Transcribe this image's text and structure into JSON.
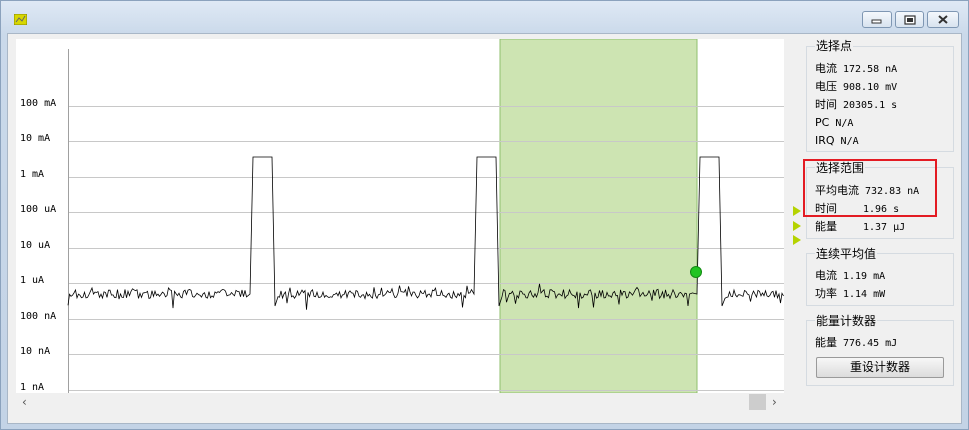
{
  "plot": {
    "y_tick_labels": [
      "100 mA",
      "10 mA",
      "1 mA",
      "100 uA",
      "10 uA",
      "1 uA",
      "100 nA",
      "10 nA",
      "1 nA"
    ],
    "selection_color": "#cde4b2",
    "trace_color": "#000000",
    "marker_color": "#22c422"
  },
  "selected_point": {
    "title": "选择点",
    "current_label": "电流",
    "current_value": "172.58 nA",
    "voltage_label": "电压",
    "voltage_value": "908.10 mV",
    "time_label": "时间",
    "time_value": "20305.1 s",
    "pc_label": "PC",
    "pc_value": "N/A",
    "irq_label": "IRQ",
    "irq_value": "N/A"
  },
  "selection_range": {
    "title": "选择范围",
    "avg_current_label": "平均电流",
    "avg_current_value": "732.83 nA",
    "time_label": "时间",
    "time_value": "1.96 s",
    "energy_label": "能量",
    "energy_value": "1.37 μJ",
    "highlight_color": "#e31b23"
  },
  "running_average": {
    "title": "连续平均值",
    "current_label": "电流",
    "current_value": "1.19 mA",
    "power_label": "功率",
    "power_value": "1.14 mW"
  },
  "energy_counter": {
    "title": "能量计数器",
    "energy_label": "能量",
    "energy_value": "776.45 mJ",
    "reset_label": "重设计数器"
  },
  "scrollbar": {
    "left_arrow": "‹",
    "right_arrow": "›"
  },
  "side_marker_color": "#b5d300"
}
